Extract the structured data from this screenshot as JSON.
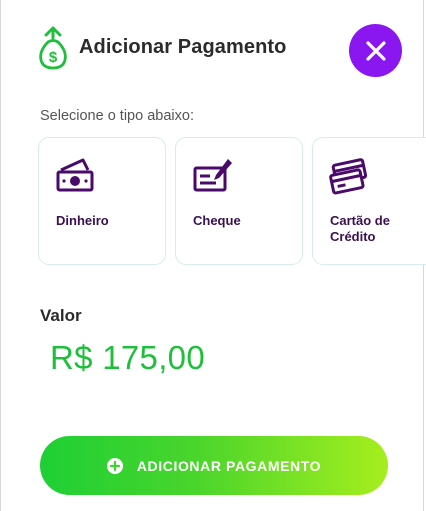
{
  "header": {
    "title": "Adicionar Pagamento",
    "icon": "money-bag-icon",
    "close_icon": "close-icon"
  },
  "subtitle": "Selecione o tipo abaixo:",
  "payment_types": [
    {
      "label": "Dinheiro",
      "icon": "cash-icon"
    },
    {
      "label": "Cheque",
      "icon": "check-icon"
    },
    {
      "label": "Cartão de Crédito",
      "icon": "credit-card-icon"
    }
  ],
  "valor": {
    "label": "Valor",
    "value": "R$ 175,00"
  },
  "action": {
    "label": "ADICIONAR PAGAMENTO",
    "icon": "plus-circle-icon"
  },
  "colors": {
    "accent_purple": "#8a17f0",
    "icon_purple": "#4a0a6a",
    "green": "#1fbf3c",
    "button_gradient_start": "#1ecf35",
    "button_gradient_end": "#a6ee1d"
  }
}
